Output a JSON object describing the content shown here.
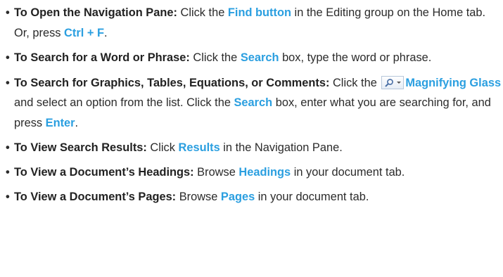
{
  "items": [
    {
      "lead": "To Open the Navigation Pane:",
      "p1": " Click the ",
      "h1": "Find button",
      "p2": " in the Editing group on the Home tab. Or, press ",
      "h2": "Ctrl + F",
      "p3": "."
    },
    {
      "lead": "To Search for a Word or Phrase:",
      "p1": " Click the ",
      "h1": "Search",
      "p2": " box, type the word or phrase."
    },
    {
      "lead": "To Search for Graphics, Tables, Equations, or Comments:",
      "p1": " Click the ",
      "icon": "magnifying-glass-icon",
      "h1": "Magnifying Glass",
      "p2": " and select an option from the list. Click the ",
      "h2": "Search",
      "p3": " box, enter what you are searching for, and press ",
      "h3": "Enter",
      "p4": "."
    },
    {
      "lead": "To View Search Results:",
      "p1": " Click ",
      "h1": "Results",
      "p2": " in the Navigation Pane."
    },
    {
      "lead": "To View a Document’s Headings:",
      "p1": " Browse ",
      "h1": "Headings",
      "p2": " in your document tab."
    },
    {
      "lead": "To View a Document’s Pages:",
      "p1": " Browse ",
      "h1": "Pages",
      "p2": " in your document tab."
    }
  ],
  "bullet": "•",
  "colors": {
    "highlight": "#2b9fe0",
    "text": "#2b2b2b"
  }
}
